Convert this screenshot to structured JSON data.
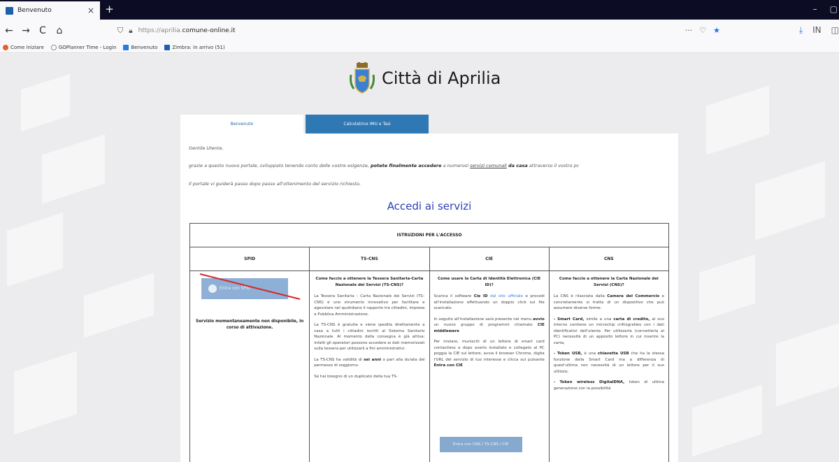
{
  "browser": {
    "tab_title": "Benvenuto",
    "tab_close": "×",
    "new_tab": "+",
    "window_controls": [
      "–",
      "▢"
    ],
    "nav": [
      "←",
      "→",
      "C",
      "⌂"
    ],
    "url_prefix": "https://aprilia.",
    "url_domain": "comune-online.it",
    "url_actions": [
      "···",
      "♡",
      "★"
    ],
    "toolbar": [
      "⤓",
      "IN",
      "◫"
    ],
    "bookmarks": [
      {
        "label": "Come iniziare",
        "color": "#e85d2a"
      },
      {
        "label": "GOPlanner Time - Login",
        "color": "#8a8a8a"
      },
      {
        "label": "Benvenuto",
        "color": "#2a7ae2"
      },
      {
        "label": "Zimbra: In arrivo (51)",
        "color": "#1d5fb4"
      }
    ]
  },
  "site": {
    "title": "Città di Aprilia",
    "tabs": [
      "Benvenuto",
      "Calcolatrice IMU e Tasi"
    ],
    "greeting": "Gentile Utente,",
    "intro_1": "grazie a questo nuovo portale, sviluppato tenendo conto delle vostre esigenze,",
    "intro_bold": "potete finalmente accedere",
    "intro_2": "a numerosi",
    "intro_link": "servizi comunali",
    "intro_bold2": "da casa",
    "intro_3": "attraverso il vostro pc",
    "guide": "Il portale vi guiderà passo dopo passo all'ottenimento del servizio richiesto.",
    "heading": "Accedi ai servizi"
  },
  "table": {
    "caption": "ISTRUZIONI PER L'ACCESSO",
    "headers": [
      "SPID",
      "TS-CNS",
      "CIE",
      "CNS"
    ],
    "spid_button": "Entra con SPID",
    "spid_msg": "Servizio momentaneamente non disponibile, in corso di attivazione.",
    "ts_title": "Come faccio a ottenere la Tessera Sanitaria-Carta Nazionale dei Servizi (TS-CNS)?",
    "ts_p1": "La Tessera Sanitaria – Carta Nazionale dei Servizi (TS–CNS) è uno strumento innovativo per facilitare e agevolare nel quotidiano il rapporto tra cittadini, imprese e Pubblica Amministrazione.",
    "ts_p2": "La TS-CNS è gratuita e viene spedita direttamente a casa a tutti i cittadini iscritti al Sistema Sanitario Nazionale. Al momento della consegna è già attiva: infatti gli operatori possono accedere ai dati memorizzati sulla tessera per utilizzarli a fini amministrativi.",
    "ts_p3a": "La TS-CNS ha validità di",
    "ts_p3b": "sei anni",
    "ts_p3c": "o pari alla durata del permesso di soggiorno.",
    "ts_p4": "Se hai bisogno di un duplicato della tua TS-",
    "cie_title": "Come usare la Carta di Identità Elettronica (CIE ID)?",
    "cie_p1a": "Scarica il software",
    "cie_p1b": "Cie ID",
    "cie_p1link": "dal sito ufficiale",
    "cie_p1c": "e procedi all'installazione effettuando un doppio click sul file scaricato.",
    "cie_p2a": "In seguito all'installazione sarà presente nel menu",
    "cie_p2b": "avvio",
    "cie_p2c": "un nuovo gruppo di programmi chiamato",
    "cie_p2d": "CIE middleware",
    "cie_p3a": "Per iniziare, munisciti di un lettore di smart card contactless e dopo averlo installato e collegato al PC poggia la CIE sul lettore, avvia il browser Chrome, digita l'URL del servizio di tuo interesse e clicca sul pulsante",
    "cie_p3b": "Entra con CIE",
    "cie_button": "Entra con CNS / TS-CNS / CIE",
    "cns_title": "Come faccio a ottenere la Carta Nazionale dei Servizi (CNS)?",
    "cns_p1a": "La CNS è rilasciata dalla",
    "cns_p1b": "Camera del Commercio",
    "cns_p1c": "e concretamente si tratta di un dispositivo che può assumere diverse forme:",
    "cns_p2a": "- Smart Card,",
    "cns_p2b": "simile a una",
    "cns_p2c": "carta di credito,",
    "cns_p2d": "al suo interno contiene un microchip crittografato con i dati identificativi dell'utente. Per utilizzarla (connetterla al PC) necessità di un apposito lettore in cui inserire la carta;",
    "cns_p3a": "- Token USB,",
    "cns_p3b": "è una",
    "cns_p3c": "chiavetta USB",
    "cns_p3d": "che ha la stessa funzione della Smart Card ma a differenza di quest'ultima non necessità di un lettore per il suo utilizzo;",
    "cns_p4a": "- Token wireless DigitalDNA,",
    "cns_p4b": "token di ultima generazione con la possibilità"
  }
}
